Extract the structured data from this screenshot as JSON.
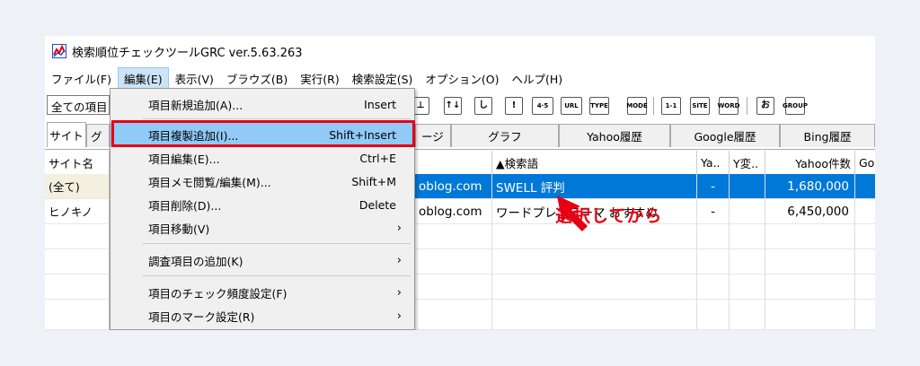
{
  "window": {
    "title": "検索順位チェックツールGRC  ver.5.63.263"
  },
  "menubar": [
    "ファイル(F)",
    "編集(E)",
    "表示(V)",
    "ブラウズ(B)",
    "実行(R)",
    "検索設定(S)",
    "オプション(O)",
    "ヘルプ(H)"
  ],
  "toolbar": {
    "combo_value": "全ての項目",
    "buttons": [
      "⊥",
      "↑↓",
      "し",
      "!",
      "4·5",
      "URL",
      "TYPE",
      "MODE",
      "1-1",
      "SITE",
      "WORD",
      "お",
      "GROUP"
    ]
  },
  "tabs": {
    "site": "サイト",
    "site_partial": "グ",
    "page_partial": "ージ",
    "graph": "グラフ",
    "yahoo_history": "Yahoo履歴",
    "google_history": "Google履歴",
    "bing_history": "Bing履歴"
  },
  "left_panel": {
    "header": "サイト名",
    "items": [
      "(全て)",
      "ヒノキノ"
    ]
  },
  "grid": {
    "headers": {
      "keyword": "▲検索語",
      "ya": "Ya..",
      "y_change": "Y変..",
      "yahoo_count": "Yahoo件数",
      "g_partial": "Go"
    },
    "rows": [
      {
        "url": "oblog.com",
        "keyword": "SWELL 評判",
        "ya": "-",
        "yahoo_count": "1,680,000"
      },
      {
        "url": "oblog.com",
        "keyword": "ワードプレステーマ おすすめ",
        "ya": "-",
        "yahoo_count": "6,450,000"
      }
    ]
  },
  "dropdown": {
    "items": [
      {
        "label": "項目新規追加(A)...",
        "shortcut": "Insert"
      },
      {
        "label": "項目複製追加(I)...",
        "shortcut": "Shift+Insert"
      },
      {
        "label": "項目編集(E)...",
        "shortcut": "Ctrl+E"
      },
      {
        "label": "項目メモ閲覧/編集(M)...",
        "shortcut": "Shift+M"
      },
      {
        "label": "項目削除(D)...",
        "shortcut": "Delete"
      },
      {
        "label": "項目移動(V)",
        "shortcut": "›"
      },
      {
        "label": "調査項目の追加(K)",
        "shortcut": "›"
      },
      {
        "label": "項目のチェック頻度設定(F)",
        "shortcut": "›"
      },
      {
        "label": "項目のマーク設定(R)",
        "shortcut": "›"
      }
    ]
  },
  "annotation": "選択してから",
  "colors": {
    "accent_red": "#e60012",
    "selection_blue": "#0078d7",
    "menu_highlight": "#91c9f7"
  }
}
